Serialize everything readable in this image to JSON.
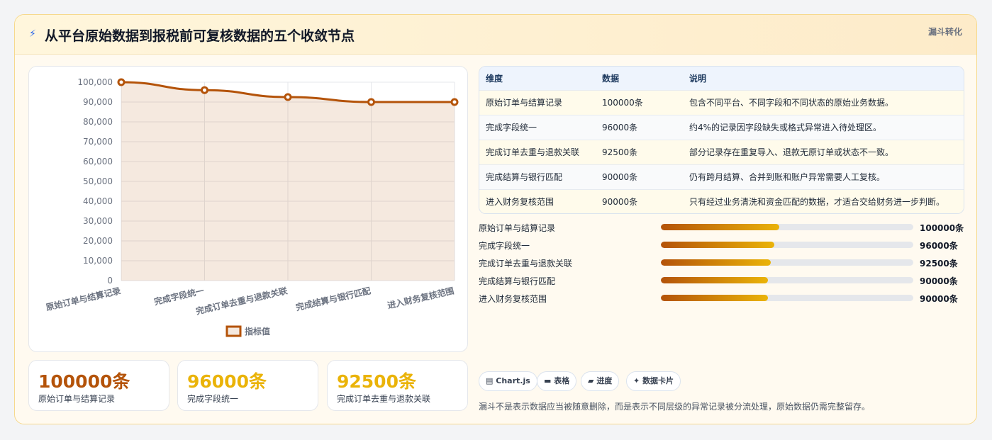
{
  "header": {
    "icon": "bolt-icon",
    "title": "从平台原始数据到报税前可复核数据的五个收敛节点",
    "tag": "漏斗转化"
  },
  "colors": {
    "accent": "#b45309",
    "gold": "#eab308",
    "stat1": "#b45309",
    "stat2": "#eab308",
    "stat3": "#eab308"
  },
  "chart_data": {
    "type": "area",
    "categories": [
      "原始订单与结算记录",
      "完成字段统一",
      "完成订单去重与退款关联",
      "完成结算与银行匹配",
      "进入财务复核范围"
    ],
    "series": [
      {
        "name": "指标值",
        "values": [
          100000,
          96000,
          92500,
          90000,
          90000
        ]
      }
    ],
    "ylim": [
      0,
      100000
    ],
    "yticks": [
      "100,000",
      "90,000",
      "80,000",
      "70,000",
      "60,000",
      "50,000",
      "40,000",
      "30,000",
      "20,000",
      "10,000",
      "0"
    ],
    "grid": true,
    "legend": "bottom"
  },
  "stats": [
    {
      "value": "100000条",
      "label": "原始订单与结算记录"
    },
    {
      "value": "96000条",
      "label": "完成字段统一"
    },
    {
      "value": "92500条",
      "label": "完成订单去重与退款关联"
    }
  ],
  "table": {
    "headers": [
      "维度",
      "数据",
      "说明"
    ],
    "rows": [
      [
        "原始订单与结算记录",
        "100000条",
        "包含不同平台、不同字段和不同状态的原始业务数据。"
      ],
      [
        "完成字段统一",
        "96000条",
        "约4%的记录因字段缺失或格式异常进入待处理区。"
      ],
      [
        "完成订单去重与退款关联",
        "92500条",
        "部分记录存在重复导入、退款无原订单或状态不一致。"
      ],
      [
        "完成结算与银行匹配",
        "90000条",
        "仍有跨月结算、合并到账和账户异常需要人工复核。"
      ],
      [
        "进入财务复核范围",
        "90000条",
        "只有经过业务清洗和资金匹配的数据，才适合交给财务进一步判断。"
      ]
    ]
  },
  "bars": [
    {
      "label": "原始订单与结算记录",
      "value": "100000条",
      "fraction": 0.47
    },
    {
      "label": "完成字段统一",
      "value": "96000条",
      "fraction": 0.45
    },
    {
      "label": "完成订单去重与退款关联",
      "value": "92500条",
      "fraction": 0.435
    },
    {
      "label": "完成结算与银行匹配",
      "value": "90000条",
      "fraction": 0.425
    },
    {
      "label": "进入财务复核范围",
      "value": "90000条",
      "fraction": 0.425
    }
  ],
  "chips": [
    {
      "icon": "chart-icon",
      "glyph": "▤",
      "label": "Chart.js"
    },
    {
      "icon": "table-icon",
      "glyph": "▬",
      "label": "表格"
    },
    {
      "icon": "progress-icon",
      "glyph": "▰",
      "label": "进度"
    },
    {
      "icon": "card-icon",
      "glyph": "✦",
      "label": "数据卡片"
    }
  ],
  "footnote": "漏斗不是表示数据应当被随意删除，而是表示不同层级的异常记录被分流处理，原始数据仍需完整留存。"
}
